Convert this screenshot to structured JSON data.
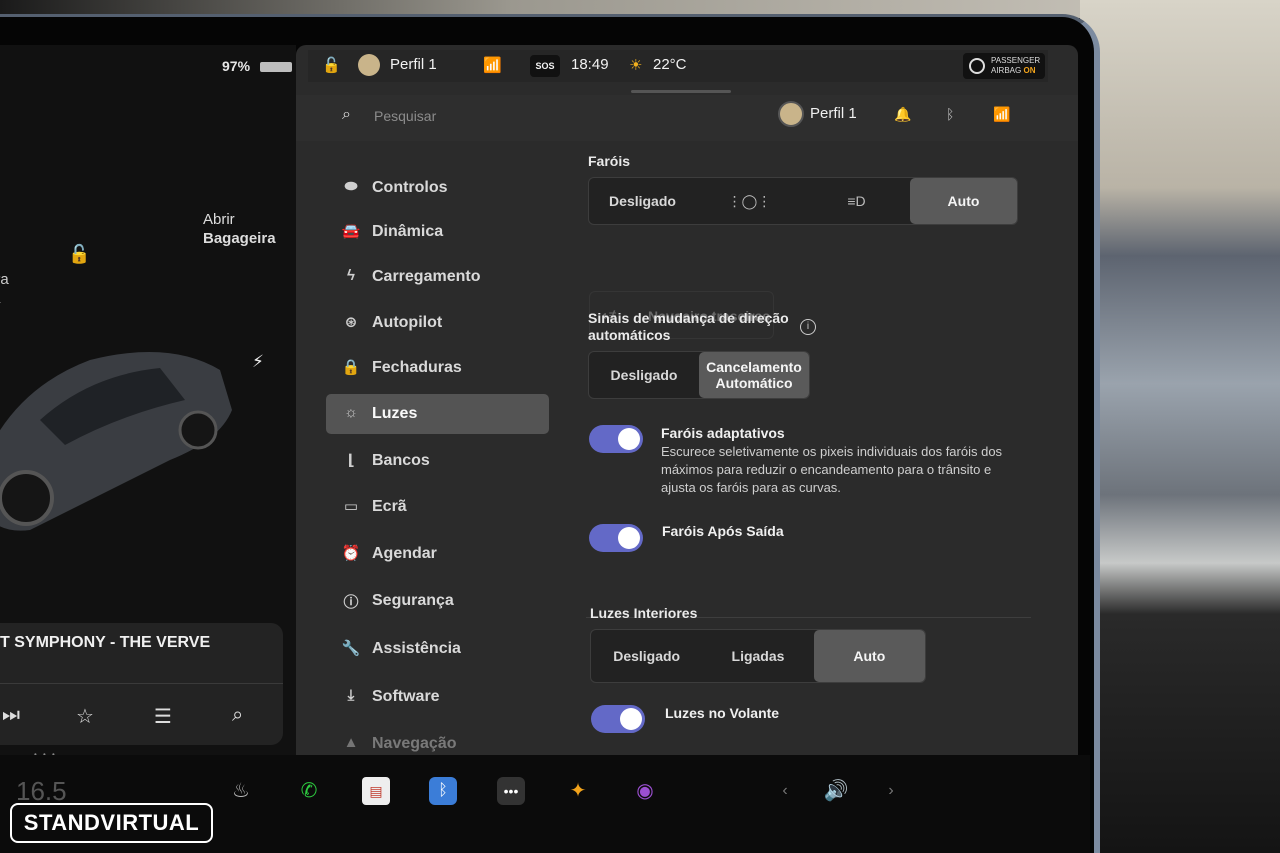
{
  "status": {
    "battery_pct": "97%",
    "profile": "Perfil 1",
    "sos": "SOS",
    "time": "18:49",
    "temperature": "22°C",
    "airbag_line1": "PASSENGER",
    "airbag_line2": "AIRBAG",
    "airbag_state": "ON"
  },
  "car_view": {
    "trunk_line1": "Abrir",
    "trunk_line2": "Bagageira",
    "frunk_line1": "ira",
    "frunk_line2": "a"
  },
  "media": {
    "now_playing": "T SYMPHONY - THE VERVE"
  },
  "header": {
    "search_placeholder": "Pesquisar",
    "profile_name": "Perfil 1"
  },
  "sidebar": {
    "items": [
      {
        "label": "Controlos",
        "icon": "toggle-icon"
      },
      {
        "label": "Dinâmica",
        "icon": "car-icon"
      },
      {
        "label": "Carregamento",
        "icon": "bolt-icon"
      },
      {
        "label": "Autopilot",
        "icon": "steering-wheel-icon"
      },
      {
        "label": "Fechaduras",
        "icon": "lock-icon"
      },
      {
        "label": "Luzes",
        "icon": "sun-icon",
        "active": true
      },
      {
        "label": "Bancos",
        "icon": "seat-icon"
      },
      {
        "label": "Ecrã",
        "icon": "display-icon"
      },
      {
        "label": "Agendar",
        "icon": "alarm-icon"
      },
      {
        "label": "Segurança",
        "icon": "alert-icon"
      },
      {
        "label": "Assistência",
        "icon": "wrench-icon"
      },
      {
        "label": "Software",
        "icon": "download-icon"
      },
      {
        "label": "Navegação",
        "icon": "navigation-icon"
      }
    ]
  },
  "lights": {
    "headlights_label": "Faróis",
    "headlights_options": [
      "Desligado",
      "",
      "",
      "Auto"
    ],
    "headlights_selected": "Auto",
    "fog_label": "Nevoeiro traseiras",
    "turn_signal_label_1": "Sinais de mudança de direção",
    "turn_signal_label_2": "automáticos",
    "turn_signal_options": [
      "Desligado",
      "Cancelamento Automático"
    ],
    "turn_signal_selected": "Cancelamento Automático",
    "adaptive_title": "Faróis adaptativos",
    "adaptive_desc": "Escurece seletivamente os pixeis individuais dos faróis dos máximos para reduzir o encandeamento para o trânsito e ajusta os faróis para as curvas.",
    "adaptive_on": true,
    "after_exit_title": "Faróis Após Saída",
    "after_exit_on": true,
    "interior_label": "Luzes Interiores",
    "interior_options": [
      "Desligado",
      "Ligadas",
      "Auto"
    ],
    "interior_selected": "Auto",
    "steering_title": "Luzes no Volante",
    "steering_on": true
  },
  "dock": {
    "speed": "16.5",
    "icons": [
      "defrost-icon",
      "phone-icon",
      "notepad-icon",
      "bluetooth-icon",
      "more-icon",
      "toybox-icon",
      "camera-icon",
      "chevron-left-icon",
      "volume-icon",
      "chevron-right-icon"
    ]
  },
  "watermark": "STANDVIRTUAL",
  "colors": {
    "toggle_on": "#6369c7",
    "panel_bg": "#2b2b2b",
    "selected_segment": "#5a5a5a",
    "airbag_on": "#f2a31b"
  }
}
